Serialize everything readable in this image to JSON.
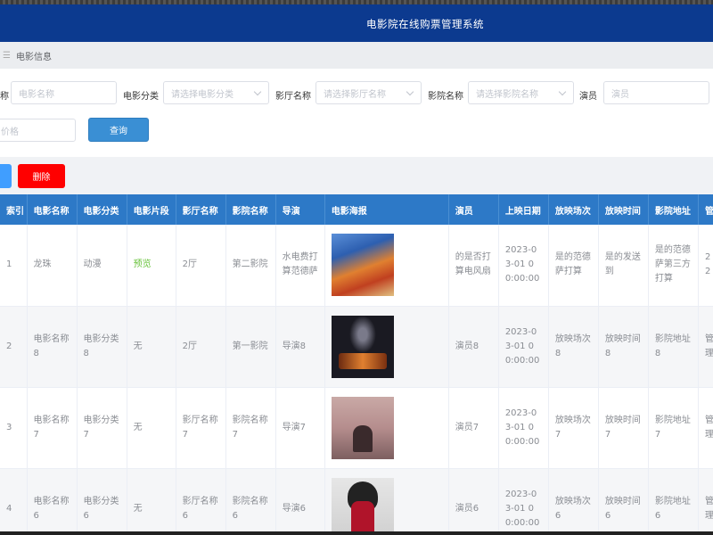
{
  "header": {
    "title": "电影院在线购票管理系统"
  },
  "breadcrumb": {
    "label": "电影信息"
  },
  "filters": {
    "name_label": "称",
    "name_placeholder": "电影名称",
    "category_label": "电影分类",
    "category_placeholder": "请选择电影分类",
    "hall_label": "影厅名称",
    "hall_placeholder": "请选择影厅名称",
    "cinema_label": "影院名称",
    "cinema_placeholder": "请选择影院名称",
    "actor_label": "演员",
    "actor_placeholder": "演员",
    "row2_placeholder": "价格",
    "query_label": "查询"
  },
  "actions": {
    "delete_label": "删除"
  },
  "table": {
    "headers": [
      "索引",
      "电影名称",
      "电影分类",
      "电影片段",
      "影厅名称",
      "影院名称",
      "导演",
      "电影海报",
      "演员",
      "上映日期",
      "放映场次",
      "放映时间",
      "影院地址",
      "管"
    ],
    "rows": [
      {
        "index": "1",
        "name": "龙珠",
        "category": "动漫",
        "clip": "预览",
        "hall": "2厅",
        "cinema": "第二影院",
        "director": "水电费打算范德萨",
        "poster": "dragonball-poster",
        "actor": "的是否打算电风扇",
        "date": "2023-03-01 00:00:00",
        "session": "是的范德萨打算",
        "time": "是的发送到",
        "address": "是的范德萨第三方打算",
        "extra": "22"
      },
      {
        "index": "2",
        "name": "电影名称8",
        "category": "电影分类8",
        "clip": "无",
        "hall": "2厅",
        "cinema": "第一影院",
        "director": "导演8",
        "poster": "dark-poster",
        "actor": "演员8",
        "date": "2023-03-01 00:00:00",
        "session": "放映场次8",
        "time": "放映时间8",
        "address": "影院地址8",
        "extra": "管理"
      },
      {
        "index": "3",
        "name": "电影名称7",
        "category": "电影分类7",
        "clip": "无",
        "hall": "影厅名称7",
        "cinema": "影院名称7",
        "director": "导演7",
        "poster": "couple-poster",
        "actor": "演员7",
        "date": "2023-03-01 00:00:00",
        "session": "放映场次7",
        "time": "放映时间7",
        "address": "影院地址7",
        "extra": "管理"
      },
      {
        "index": "4",
        "name": "电影名称6",
        "category": "电影分类6",
        "clip": "无",
        "hall": "影厅名称6",
        "cinema": "影院名称6",
        "director": "导演6",
        "poster": "portrait-poster",
        "actor": "演员6",
        "date": "2023-03-01 00:00:00",
        "session": "放映场次6",
        "time": "放映时间6",
        "address": "影院地址6",
        "extra": "管理"
      }
    ]
  }
}
